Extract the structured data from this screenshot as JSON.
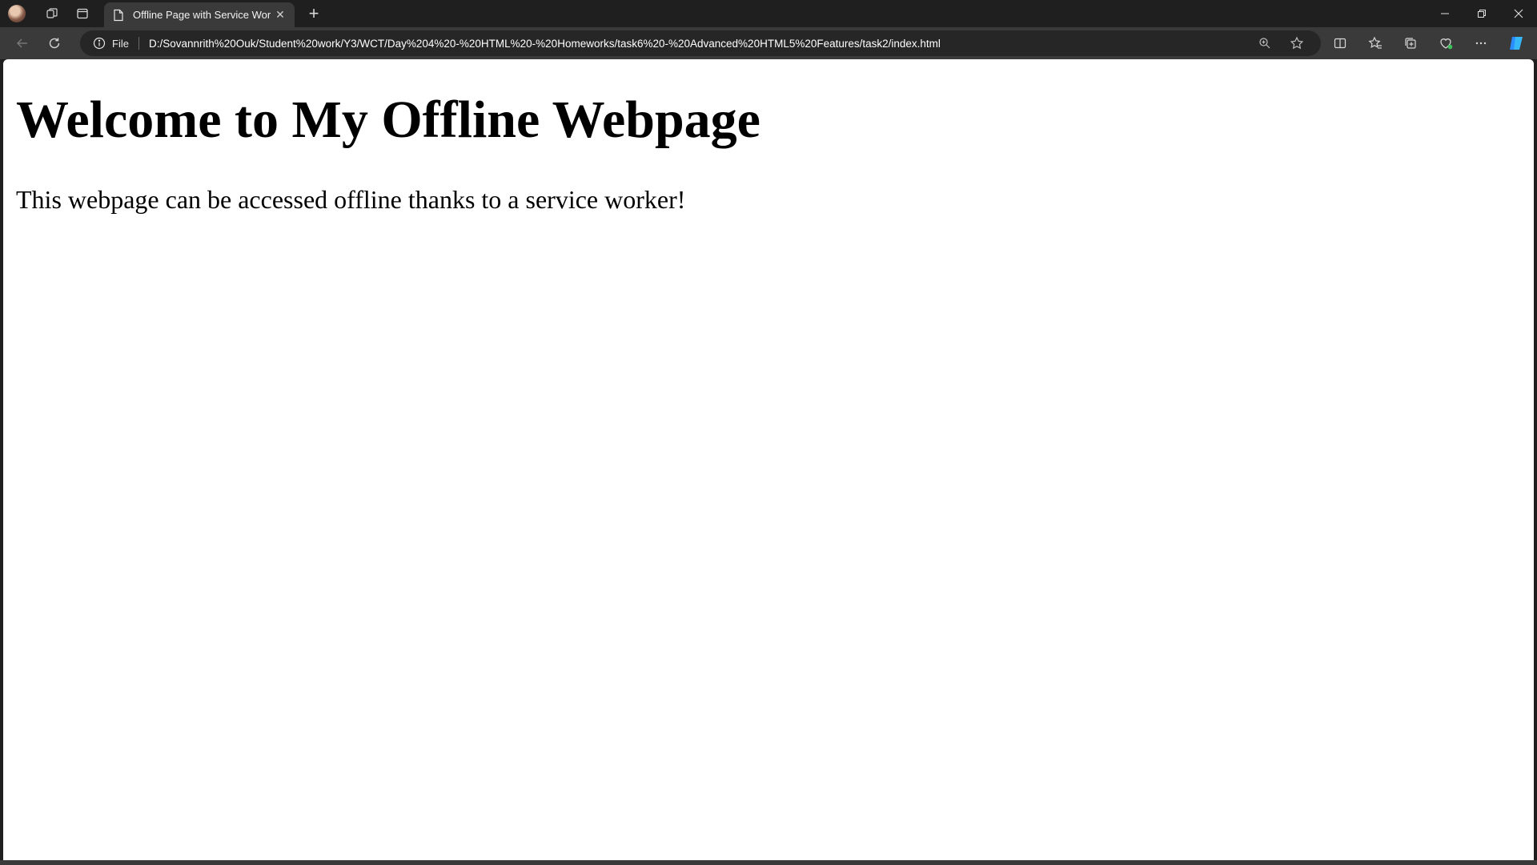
{
  "browser": {
    "tab": {
      "title": "Offline Page with Service Worker",
      "favicon": "page-icon",
      "close_symbol": "✕"
    },
    "new_tab_symbol": "+",
    "address_bar": {
      "site_info_label": "File",
      "url": "D:/Sovannrith%20Ouk/Student%20work/Y3/WCT/Day%204%20-%20HTML%20-%20Homeworks/task6%20-%20Advanced%20HTML5%20Features/task2/index.html"
    },
    "colors": {
      "chrome_dark": "#1f1f1f",
      "toolbar": "#3a3a3a",
      "address_bg": "#262626",
      "copilot_accent": "#2a8cff"
    }
  },
  "page": {
    "heading": "Welcome to My Offline Webpage",
    "paragraph": "This webpage can be accessed offline thanks to a service worker!"
  }
}
